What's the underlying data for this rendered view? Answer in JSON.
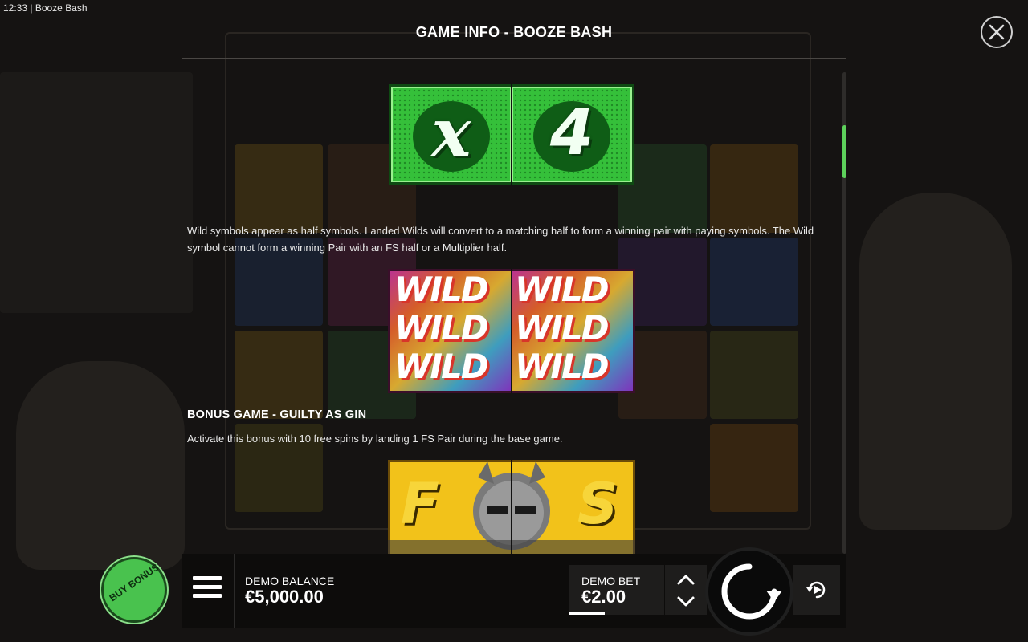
{
  "window": {
    "time": "12:33",
    "app_title": "Booze Bash"
  },
  "info": {
    "title": "GAME INFO - BOOZE BASH",
    "multiplier_symbol": {
      "left": "x",
      "right": "4"
    },
    "wild_paragraph": "Wild symbols appear as half symbols. Landed Wilds will convert to a matching half to form a winning pair with paying symbols. The Wild symbol cannot form a winning Pair with an FS half or a Multiplier half.",
    "wild_symbol_text": [
      "WILD",
      "WILD",
      "WILD"
    ],
    "bonus_heading": "BONUS GAME - GUILTY AS GIN",
    "bonus_paragraph": "Activate this bonus with 10 free spins by landing 1 FS Pair during the base game.",
    "fs_symbol": {
      "left": "F",
      "right": "S"
    }
  },
  "controls": {
    "buy_bonus_label": "BUY BONUS",
    "balance_label": "DEMO BALANCE",
    "balance_value": "€5,000.00",
    "bet_label": "DEMO BET",
    "bet_value": "€2.00"
  },
  "colors": {
    "accent_green": "#5dd15b",
    "multiplier_green": "#2fb836",
    "fs_gold": "#f2c21a",
    "background": "#151312"
  },
  "icons": [
    "close-icon",
    "menu-icon",
    "chevron-up-icon",
    "chevron-down-icon",
    "spin-icon",
    "autoplay-icon"
  ]
}
